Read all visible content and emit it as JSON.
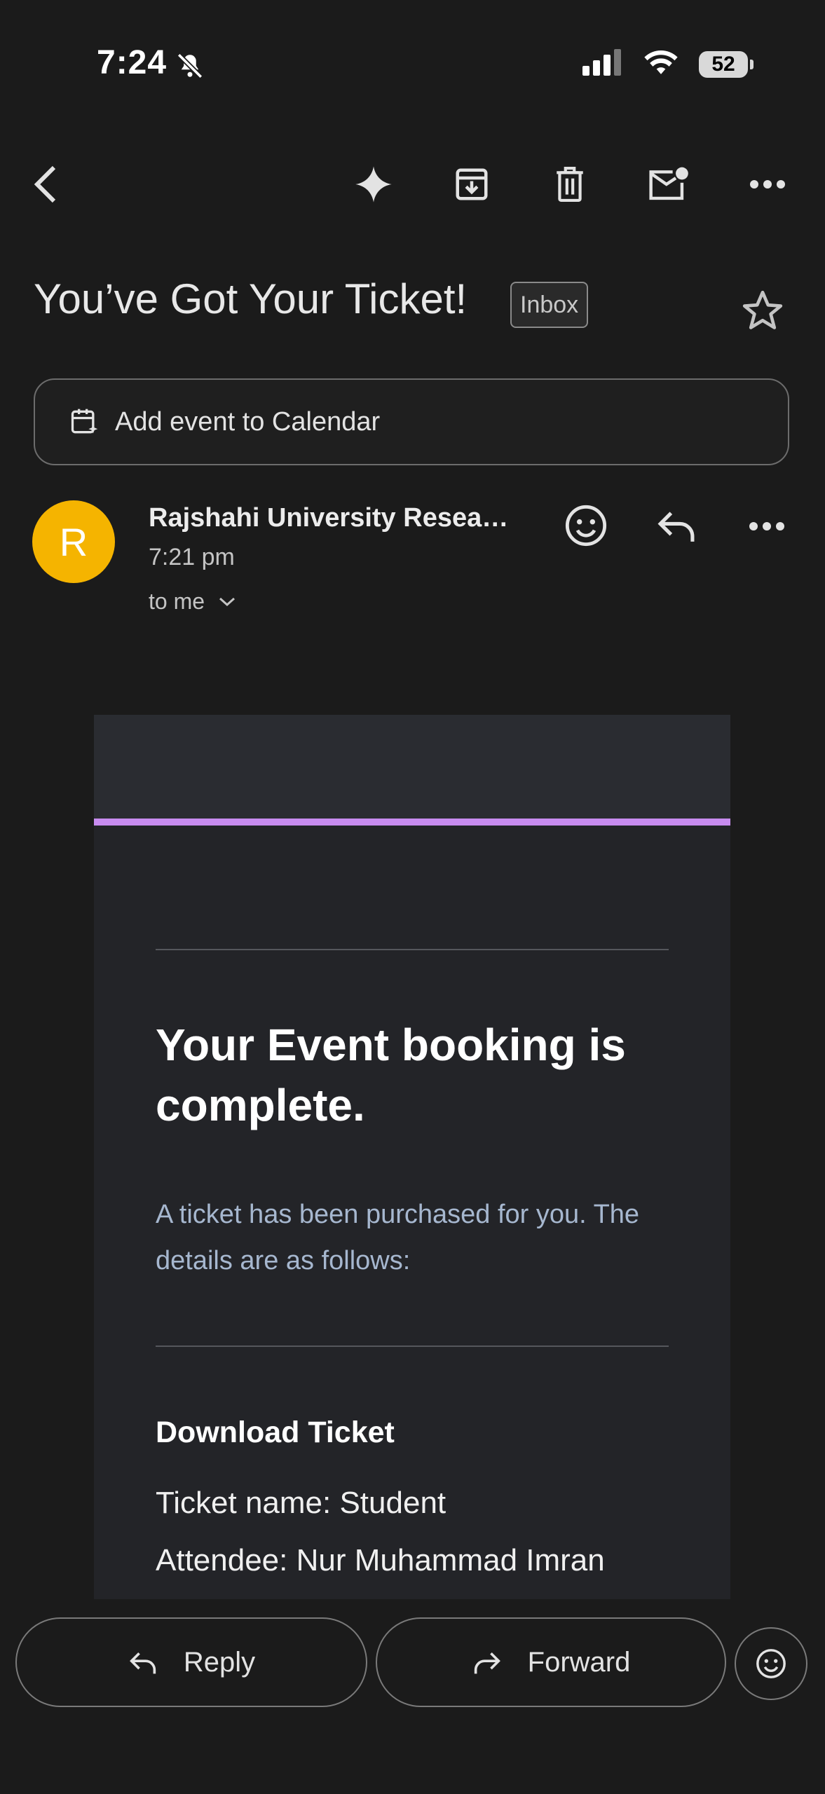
{
  "status": {
    "time": "7:24",
    "battery": "52"
  },
  "subject": {
    "title": "You’ve Got Your Ticket!",
    "label": "Inbox"
  },
  "calendar": {
    "label": "Add event to Calendar"
  },
  "sender": {
    "initial": "R",
    "name": "Rajshahi University Resea…",
    "time": "7:21 pm",
    "recipient": "to me"
  },
  "email": {
    "heading": "Your Event booking is complete.",
    "intro": "A ticket has been purchased for you. The details are as follows:",
    "section_title": "Download Ticket",
    "ticket_name": "Ticket name: Student",
    "attendee": "Attendee: Nur Muhammad Imran"
  },
  "actions": {
    "reply": "Reply",
    "forward": "Forward"
  },
  "colors": {
    "avatar": "#f5b400",
    "accent_bar": "#c88cf0"
  }
}
